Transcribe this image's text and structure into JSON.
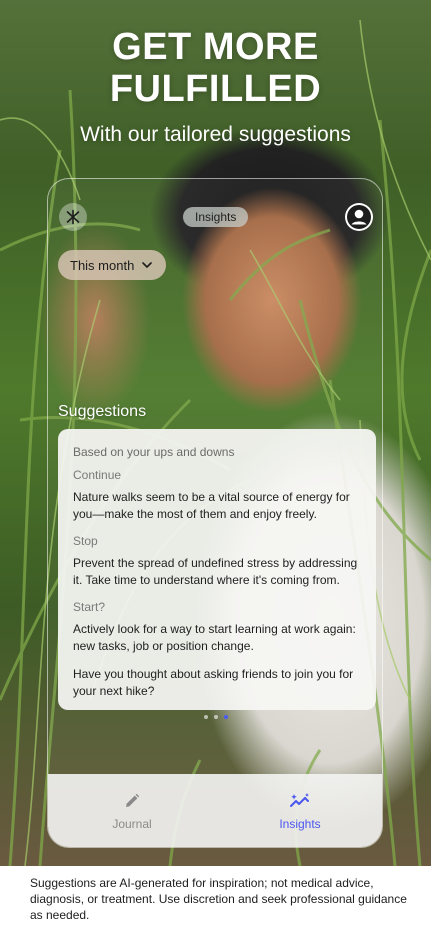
{
  "headline": {
    "line1": "GET MORE",
    "line2": "FULFILLED",
    "subtitle": "With our tailored suggestions"
  },
  "app": {
    "header_chip": "Insights",
    "period_select": "This month",
    "section_title": "Suggestions",
    "card": {
      "intro": "Based on your ups and downs",
      "items": [
        {
          "label": "Continue",
          "text": "Nature walks seem to be a vital source of energy for you—make the most of them and enjoy freely."
        },
        {
          "label": "Stop",
          "text": "Prevent the spread of undefined stress by addressing it. Take time to understand where it's coming from."
        },
        {
          "label": "Start?",
          "text": "Actively look for a way to start learning at work again: new tasks, job or position change."
        }
      ],
      "closing": "Have you thought about asking friends to join you for your next hike?"
    },
    "tabs": [
      {
        "label": "Journal",
        "icon": "pencil-icon",
        "active": false
      },
      {
        "label": "Insights",
        "icon": "sparkle-chart-icon",
        "active": true
      }
    ],
    "accent_color": "#4a56f0"
  },
  "disclaimer": "Suggestions are AI-generated for inspiration; not medical advice, diagnosis, or treatment. Use discretion and seek professional guidance as needed."
}
